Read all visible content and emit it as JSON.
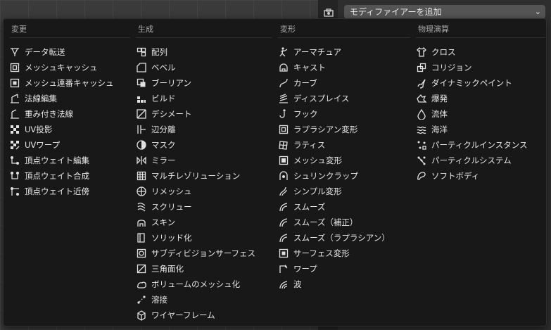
{
  "header": {
    "add_modifier_label": "モディファイアーを追加"
  },
  "menu": {
    "columns": [
      {
        "title": "変更",
        "items": [
          {
            "label": "データ転送",
            "icon": "data-transfer-icon"
          },
          {
            "label": "メッシュキャッシュ",
            "icon": "mesh-cache-icon"
          },
          {
            "label": "メッシュ連番キャッシュ",
            "icon": "mesh-sequence-cache-icon"
          },
          {
            "label": "法線編集",
            "icon": "normal-edit-icon"
          },
          {
            "label": "重み付き法線",
            "icon": "weighted-normal-icon"
          },
          {
            "label": "UV投影",
            "icon": "uv-project-icon"
          },
          {
            "label": "UVワープ",
            "icon": "uv-warp-icon"
          },
          {
            "label": "頂点ウェイト編集",
            "icon": "vertex-weight-edit-icon"
          },
          {
            "label": "頂点ウェイト合成",
            "icon": "vertex-weight-mix-icon"
          },
          {
            "label": "頂点ウェイト近傍",
            "icon": "vertex-weight-proximity-icon"
          }
        ]
      },
      {
        "title": "生成",
        "items": [
          {
            "label": "配列",
            "icon": "array-icon"
          },
          {
            "label": "ベベル",
            "icon": "bevel-icon"
          },
          {
            "label": "ブーリアン",
            "icon": "boolean-icon"
          },
          {
            "label": "ビルド",
            "icon": "build-icon"
          },
          {
            "label": "デシメート",
            "icon": "decimate-icon"
          },
          {
            "label": "辺分離",
            "icon": "edge-split-icon"
          },
          {
            "label": "マスク",
            "icon": "mask-icon"
          },
          {
            "label": "ミラー",
            "icon": "mirror-icon"
          },
          {
            "label": "マルチレゾリューション",
            "icon": "multiresolution-icon"
          },
          {
            "label": "リメッシュ",
            "icon": "remesh-icon"
          },
          {
            "label": "スクリュー",
            "icon": "screw-icon"
          },
          {
            "label": "スキン",
            "icon": "skin-icon"
          },
          {
            "label": "ソリッド化",
            "icon": "solidify-icon"
          },
          {
            "label": "サブディビジョンサーフェス",
            "icon": "subdivision-surface-icon"
          },
          {
            "label": "三角面化",
            "icon": "triangulate-icon"
          },
          {
            "label": "ボリュームのメッシュ化",
            "icon": "volume-to-mesh-icon"
          },
          {
            "label": "溶接",
            "icon": "weld-icon"
          },
          {
            "label": "ワイヤーフレーム",
            "icon": "wireframe-icon"
          }
        ]
      },
      {
        "title": "変形",
        "items": [
          {
            "label": "アーマチュア",
            "icon": "armature-icon"
          },
          {
            "label": "キャスト",
            "icon": "cast-icon"
          },
          {
            "label": "カーブ",
            "icon": "curve-icon"
          },
          {
            "label": "ディスプレイス",
            "icon": "displace-icon"
          },
          {
            "label": "フック",
            "icon": "hook-icon"
          },
          {
            "label": "ラプラシアン変形",
            "icon": "laplacian-deform-icon"
          },
          {
            "label": "ラティス",
            "icon": "lattice-icon"
          },
          {
            "label": "メッシュ変形",
            "icon": "mesh-deform-icon"
          },
          {
            "label": "シュリンクラップ",
            "icon": "shrinkwrap-icon"
          },
          {
            "label": "シンプル変形",
            "icon": "simple-deform-icon"
          },
          {
            "label": "スムーズ",
            "icon": "smooth-icon"
          },
          {
            "label": "スムーズ（補正）",
            "icon": "smooth-corrective-icon"
          },
          {
            "label": "スムーズ（ラプラシアン）",
            "icon": "smooth-laplacian-icon"
          },
          {
            "label": "サーフェス変形",
            "icon": "surface-deform-icon"
          },
          {
            "label": "ワープ",
            "icon": "warp-icon"
          },
          {
            "label": "波",
            "icon": "wave-icon"
          }
        ]
      },
      {
        "title": "物理演算",
        "items": [
          {
            "label": "クロス",
            "icon": "cloth-icon"
          },
          {
            "label": "コリジョン",
            "icon": "collision-icon"
          },
          {
            "label": "ダイナミックペイント",
            "icon": "dynamic-paint-icon"
          },
          {
            "label": "爆発",
            "icon": "explode-icon"
          },
          {
            "label": "流体",
            "icon": "fluid-icon"
          },
          {
            "label": "海洋",
            "icon": "ocean-icon"
          },
          {
            "label": "パーティクルインスタンス",
            "icon": "particle-instance-icon"
          },
          {
            "label": "パーティクルシステム",
            "icon": "particle-system-icon"
          },
          {
            "label": "ソフトボディ",
            "icon": "soft-body-icon"
          }
        ]
      }
    ]
  }
}
